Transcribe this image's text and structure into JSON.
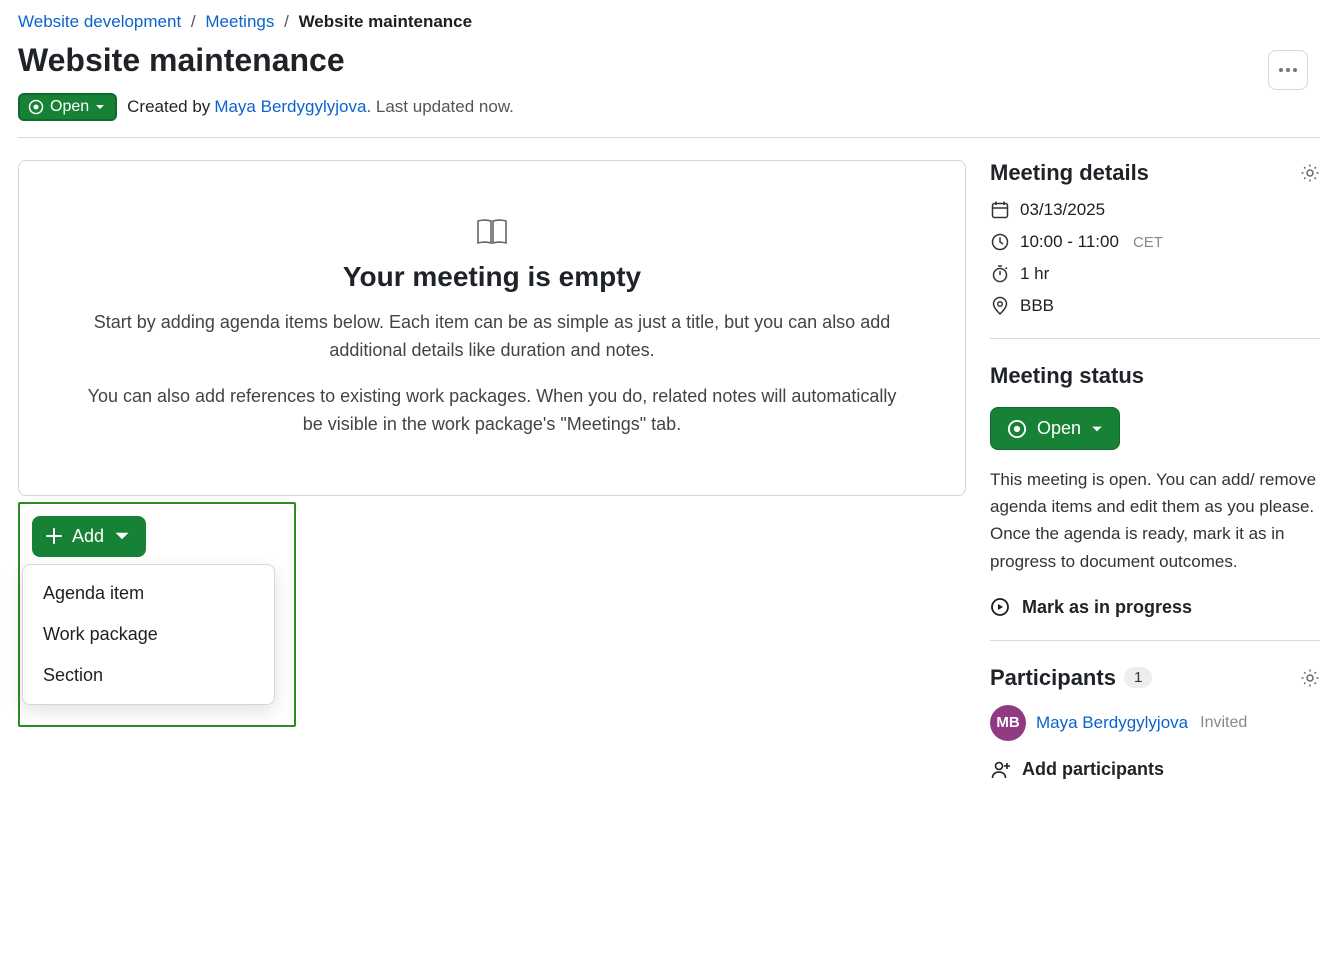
{
  "breadcrumb": {
    "project": "Website development",
    "module": "Meetings",
    "current": "Website maintenance"
  },
  "page_title": "Website maintenance",
  "status_pill": {
    "label": "Open"
  },
  "byline": {
    "created_by_label": "Created by",
    "author_name": "Maya Berdygylyjova",
    "updated_text": ". Last updated now."
  },
  "empty_state": {
    "title": "Your meeting is empty",
    "para1": "Start by adding agenda items below. Each item can be as simple as just a title, but you can also add additional details like duration and notes.",
    "para2": "You can also add references to existing work packages. When you do, related notes will automatically be visible in the work package's \"Meetings\" tab."
  },
  "add_button": {
    "label": "Add"
  },
  "add_menu": {
    "items": [
      {
        "label": "Agenda item"
      },
      {
        "label": "Work package"
      },
      {
        "label": "Section"
      }
    ]
  },
  "details": {
    "heading": "Meeting details",
    "date": "03/13/2025",
    "time": "10:00 - 11:00",
    "timezone": "CET",
    "duration": "1 hr",
    "location": "BBB"
  },
  "meeting_status": {
    "heading": "Meeting status",
    "pill_label": "Open",
    "description": "This meeting is open. You can add/ remove agenda items and edit them as you please. Once the agenda is ready, mark it as in progress to document outcomes.",
    "mark_action": "Mark as in progress"
  },
  "participants": {
    "heading": "Participants",
    "count": "1",
    "list": [
      {
        "initials": "MB",
        "name": "Maya Berdygylyjova",
        "status": "Invited"
      }
    ],
    "add_action": "Add participants"
  }
}
